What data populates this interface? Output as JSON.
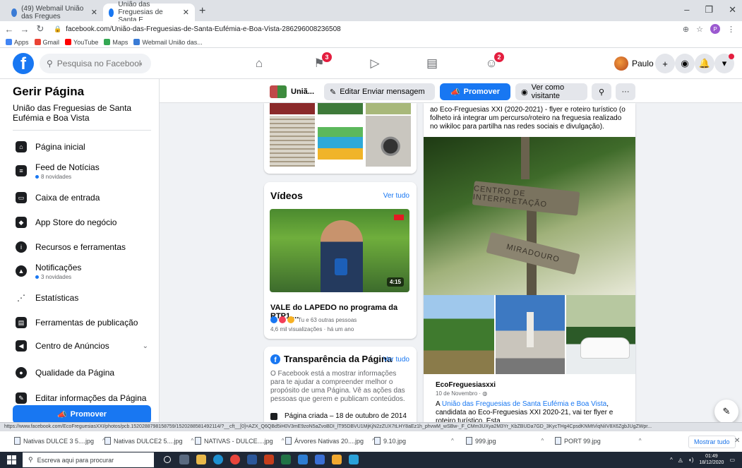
{
  "browser": {
    "tabs": [
      {
        "label": "(49) Webmail União das Fregues"
      },
      {
        "label": "União das Freguesias de Santa E"
      }
    ],
    "url": "facebook.com/União-das-Freguesias-de-Santa-Eufémia-e-Boa-Vista-286296008236508",
    "bookmarks": [
      "Apps",
      "Gmail",
      "YouTube",
      "Maps",
      "Webmail União das..."
    ],
    "status_url": "https://www.facebook.com/EcoFreguesiasXXI/photos/pcb.1520288798158759/1520288581492114/?__cft__[0]=AZX_Q6QBd5iH0V3mE9zoN5aZvoBDI_lT95DBVU1MjKjN2zZUX7tLHY8aEz1h_phvwM_wSBw-_F_CMm3UXya2M3Yr_KbZBUDa7GD_3KycTHg4CpsdKNMtViqNiIV8X6ZgbJUgZWpr..."
  },
  "fb": {
    "search_placeholder": "Pesquisa no Facebook",
    "notif_badge_pages": "3",
    "notif_badge_groups": "2",
    "user_name": "Paulo"
  },
  "sidebar": {
    "title": "Gerir Página",
    "subtitle": "União das Freguesias de Santa Eufémia e Boa Vista",
    "items": [
      {
        "label": "Página inicial",
        "note": ""
      },
      {
        "label": "Feed de Notícias",
        "note": "8 novidades"
      },
      {
        "label": "Caixa de entrada",
        "note": ""
      },
      {
        "label": "App Store do negócio",
        "note": ""
      },
      {
        "label": "Recursos e ferramentas",
        "note": ""
      },
      {
        "label": "Notificações",
        "note": "3 novidades"
      },
      {
        "label": "Estatísticas",
        "note": ""
      },
      {
        "label": "Ferramentas de publicação",
        "note": ""
      },
      {
        "label": "Centro de Anúncios",
        "note": ""
      },
      {
        "label": "Qualidade da Página",
        "note": ""
      },
      {
        "label": "Editar informações da Página",
        "note": ""
      }
    ],
    "promote_label": "Promover"
  },
  "pagebar": {
    "page_name": "Uniã...",
    "edit_button": "Editar Enviar mensagem",
    "promote_button": "Promover",
    "visitor_button": "Ver como visitante",
    "more_label": "···"
  },
  "videos_card": {
    "title": "Vídeos",
    "see_all": "Ver tudo",
    "duration": "4:15",
    "video_title": "VALE do LAPEDO no programa da RTP1 ...",
    "reactions": "Tu e 63 outras pessoas",
    "views": "4,6 mil visualizações · há um ano"
  },
  "transparency_card": {
    "title": "Transparência da Página",
    "see_all": "Ver tudo",
    "body": "O Facebook está a mostrar informações para te ajudar a compreender melhor o propósito de uma Página. Vê as ações das pessoas que gerem e publicam conteúdos.",
    "created": "Página criada – 18 de outubro de 2014"
  },
  "post": {
    "text_top": "ao Eco-Freguesias XXI (2020-2021) - flyer e roteiro turístico (o folheto irá integrar um percurso/roteiro na freguesia realizado no wikiloc para partilha nas redes sociais e divulgação).",
    "sign1": "CENTRO DE INTERPRETAÇÃO",
    "sign2": "MIRADOURO",
    "author": "EcoFreguesiasxxi",
    "date": "10 de Novembro · ",
    "body_prefix": "A ",
    "body_link": "União das Freguesias de Santa Eufémia e Boa Vista",
    "body_suffix": ", candidata ao Eco-Freguesias XXI 2020-21, vai ter flyer e roteiro turístico. Esta"
  },
  "downloads": [
    "Nativas DULCE 3 5....jpg",
    "Nativas DULCE2 5....jpg",
    "NATIVAS - DULCE....jpg",
    "Árvores Nativas 20....jpg",
    "9.10.jpg",
    "999.jpg",
    "PORT 99.jpg"
  ],
  "downloads_show_all": "Mostrar tudo",
  "taskbar": {
    "search_placeholder": "Escreva aqui para procurar",
    "time": "01:49",
    "date": "18/12/2020"
  },
  "colors": {
    "fb_blue": "#1877f2",
    "badge_red": "#e41e3f",
    "page_bg": "#f0f2f5"
  }
}
